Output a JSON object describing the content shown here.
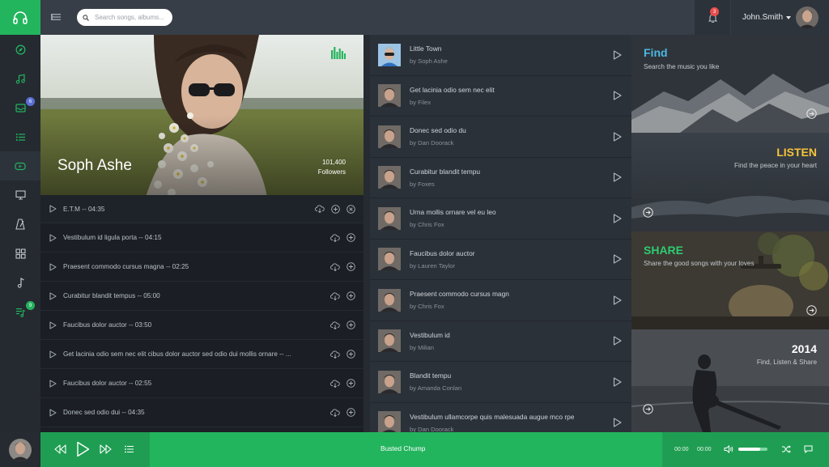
{
  "header": {
    "search_placeholder": "Search songs, albums...",
    "notifications_count": "3",
    "user_name": "John.Smith"
  },
  "nav": {
    "items": [
      {
        "icon": "compass-icon"
      },
      {
        "icon": "music-note-icon"
      },
      {
        "icon": "inbox-icon",
        "badge": "6"
      },
      {
        "icon": "list-icon"
      },
      {
        "icon": "youtube-icon"
      },
      {
        "icon": "monitor-icon"
      },
      {
        "icon": "metronome-icon"
      },
      {
        "icon": "grid-icon"
      },
      {
        "icon": "single-note-icon"
      },
      {
        "icon": "playlist-icon",
        "badge": "9"
      }
    ]
  },
  "artist": {
    "name": "Soph Ashe",
    "followers_count": "101,400",
    "followers_label": "Followers"
  },
  "tracks": [
    {
      "title": "E.T.M",
      "duration": "04:35"
    },
    {
      "title": "Vestibulum id ligula porta",
      "duration": "04:15"
    },
    {
      "title": "Praesent commodo cursus magna",
      "duration": "02:25"
    },
    {
      "title": "Curabitur blandit tempus",
      "duration": "05:00"
    },
    {
      "title": "Faucibus dolor auctor",
      "duration": "03:50"
    },
    {
      "title": "Get lacinia odio sem nec elit cibus dolor auctor sed odio dui mollis ornare",
      "duration": "..."
    },
    {
      "title": "Faucibus dolor auctor",
      "duration": "02:55"
    },
    {
      "title": "Donec sed odio dui",
      "duration": "04:35"
    }
  ],
  "songs": [
    {
      "title": "Little Town",
      "artist": "by Soph Ashe"
    },
    {
      "title": "Get lacinia odio sem nec elit",
      "artist": "by Filex"
    },
    {
      "title": "Donec sed odio du",
      "artist": "by Dan Doorack"
    },
    {
      "title": "Curabitur blandit tempu",
      "artist": "by Foxes"
    },
    {
      "title": "Urna mollis ornare vel eu leo",
      "artist": "by Chris Fox"
    },
    {
      "title": "Faucibus dolor auctor",
      "artist": "by Lauren Taylor"
    },
    {
      "title": "Praesent commodo cursus magn",
      "artist": "by Chris Fox"
    },
    {
      "title": "Vestibulum id",
      "artist": "by Milian"
    },
    {
      "title": "Blandit tempu",
      "artist": "by Amanda Conlan"
    },
    {
      "title": "Vestibulum ullamcorpe quis malesuada augue mco rpe",
      "artist": "by Dan Doorack"
    }
  ],
  "promos": [
    {
      "title": "Find",
      "subtitle": "Search the music you like",
      "color": "#4cb8e3"
    },
    {
      "title": "LISTEN",
      "subtitle": "Find the peace in your heart",
      "color": "#f5c33b"
    },
    {
      "title": "SHARE",
      "subtitle": "Share the good songs with your loves",
      "color": "#2ecc71"
    },
    {
      "title": "2014",
      "subtitle": "Find, Listen & Share",
      "color": "#ffffff"
    }
  ],
  "player": {
    "song": "Busted Chump",
    "time_current": "00:00",
    "time_total": "00:00",
    "volume": 0.75
  },
  "colors": {
    "accent": "#23b45e",
    "accent_dark": "#1f9e53",
    "badge_red": "#e84d4d",
    "badge_blue": "#5a6fd6"
  }
}
